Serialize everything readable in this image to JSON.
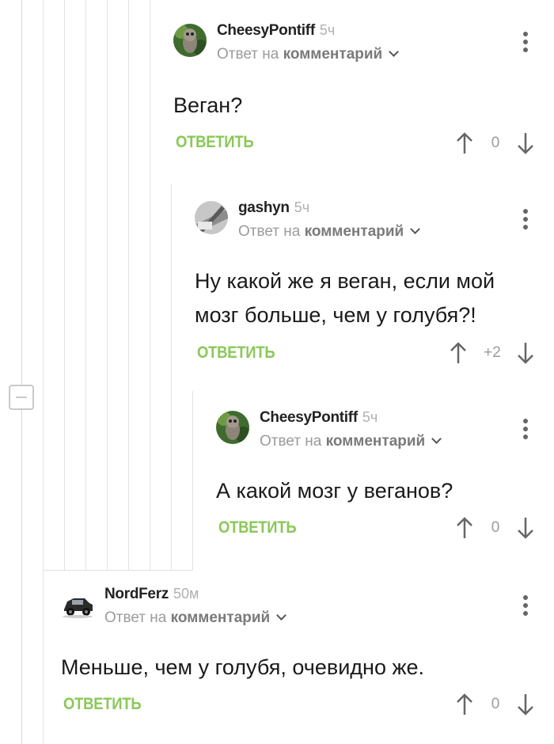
{
  "comments": [
    {
      "author": "CheesyPontiff",
      "time": "5ч",
      "reply_prefix": "Ответ на",
      "reply_target": "комментарий",
      "text_lines": [
        "Веган?"
      ],
      "reply_label": "ОТВЕТИТЬ",
      "score": "0"
    },
    {
      "author": "gashyn",
      "time": "5ч",
      "reply_prefix": "Ответ на",
      "reply_target": "комментарий",
      "text_lines": [
        "Ну какой же я веган, если мой",
        "мозг больше, чем у голубя?!"
      ],
      "reply_label": "ОТВЕТИТЬ",
      "score": "+2"
    },
    {
      "author": "CheesyPontiff",
      "time": "5ч",
      "reply_prefix": "Ответ на",
      "reply_target": "комментарий",
      "text_lines": [
        "А какой мозг у веганов?"
      ],
      "reply_label": "ОТВЕТИТЬ",
      "score": "0"
    },
    {
      "author": "NordFerz",
      "time": "50м",
      "reply_prefix": "Ответ на",
      "reply_target": "комментарий",
      "text_lines": [
        "Меньше, чем у голубя, очевидно же."
      ],
      "reply_label": "ОТВЕТИТЬ",
      "score": "0"
    }
  ],
  "icons": {
    "collapse": "minus-box-icon",
    "more": "more-vertical-icon",
    "upvote": "arrow-up-icon",
    "downvote": "arrow-down-icon",
    "dropdown": "chevron-down-icon"
  },
  "colors": {
    "reply_button": "#8ac858",
    "thread_line": "#e3e3e3",
    "author": "#222222",
    "muted": "#9b9b9b"
  }
}
